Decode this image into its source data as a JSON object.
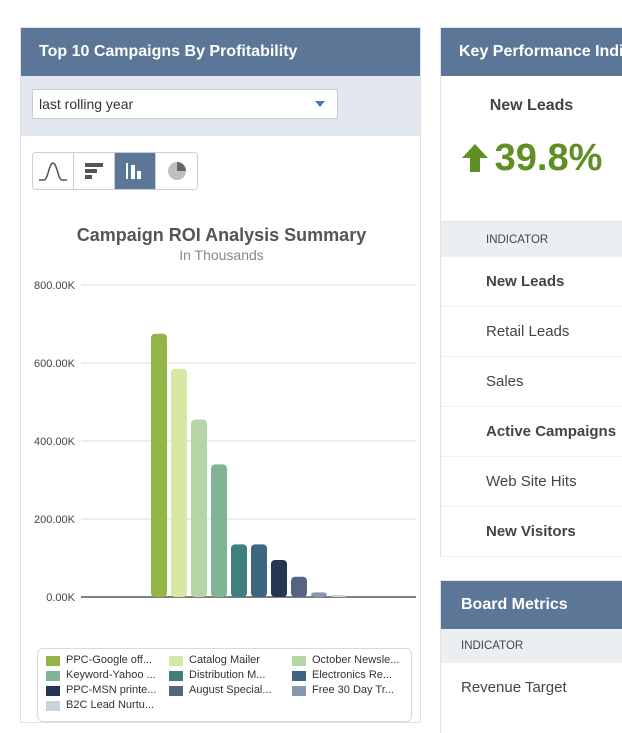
{
  "left_panel": {
    "title": "Top 10 Campaigns By Profitability",
    "period_select": {
      "value": "last rolling year"
    },
    "chart_type_buttons": [
      "line-chart-icon",
      "horizontal-bar-chart-icon",
      "column-chart-icon",
      "pie-chart-icon"
    ],
    "active_chart_type": "column-chart-icon"
  },
  "chart_data": {
    "type": "bar",
    "title": "Campaign ROI Analysis Summary",
    "subtitle": "In Thousands",
    "ylim": [
      0,
      800
    ],
    "y_ticks": [
      {
        "value": 0,
        "label": "0.00K"
      },
      {
        "value": 200,
        "label": "200.00K"
      },
      {
        "value": 400,
        "label": "400.00K"
      },
      {
        "value": 600,
        "label": "600.00K"
      },
      {
        "value": 800,
        "label": "800.00K"
      }
    ],
    "grid": true,
    "categories": [
      "PPC-Google off...",
      "Catalog Mailer",
      "October Newsle...",
      "Keyword-Yahoo ...",
      "Distribution M...",
      "Electronics Re...",
      "PPC-MSN printe...",
      "August Special...",
      "Free 30 Day Tr...",
      "B2C Lead Nurtu..."
    ],
    "values": [
      675,
      585,
      455,
      340,
      135,
      135,
      95,
      52,
      12,
      5
    ],
    "colors": [
      "#93b546",
      "#d6e8a4",
      "#b6d5a4",
      "#7fb596",
      "#3f7f7d",
      "#3d6780",
      "#243650",
      "#56657f",
      "#8797ad",
      "#cbd2db"
    ],
    "legend_position": "bottom"
  },
  "kpi_panel": {
    "title": "Key Performance Indicators",
    "metric_name": "New Leads",
    "metric_value": "39.8%",
    "trend": "up-arrow-icon",
    "trend_color": "#5f8f25",
    "column_header": "INDICATOR",
    "rows": [
      {
        "label": "New Leads",
        "bold": true
      },
      {
        "label": "Retail Leads",
        "bold": false
      },
      {
        "label": "Sales",
        "bold": false
      },
      {
        "label": "Active Campaigns",
        "bold": true
      },
      {
        "label": "Web Site Hits",
        "bold": false
      },
      {
        "label": "New Visitors",
        "bold": true
      }
    ]
  },
  "board_panel": {
    "title": "Board Metrics",
    "column_header": "INDICATOR",
    "rows": [
      "Revenue Target"
    ]
  },
  "colors": {
    "header": "#5b7696",
    "positive": "#5f8f25"
  }
}
